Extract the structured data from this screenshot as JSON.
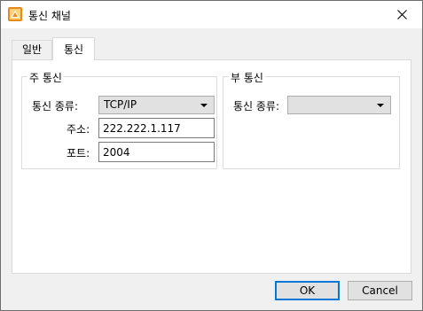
{
  "window": {
    "title": "통신 채널",
    "close_glyph": "✕"
  },
  "tabs": [
    {
      "label": "일반",
      "active": false
    },
    {
      "label": "통신",
      "active": true
    }
  ],
  "primary": {
    "group_title": "주 통신",
    "type_label": "통신 종류:",
    "type_value": "TCP/IP",
    "address_label": "주소:",
    "address_value": "222.222.1.117",
    "port_label": "포트:",
    "port_value": "2004"
  },
  "secondary": {
    "group_title": "부 통신",
    "type_label": "통신 종류:",
    "type_value": ""
  },
  "buttons": {
    "ok": "OK",
    "cancel": "Cancel"
  },
  "colors": {
    "default_button_border": "#0078d7",
    "icon_orange": "#e8891c"
  }
}
